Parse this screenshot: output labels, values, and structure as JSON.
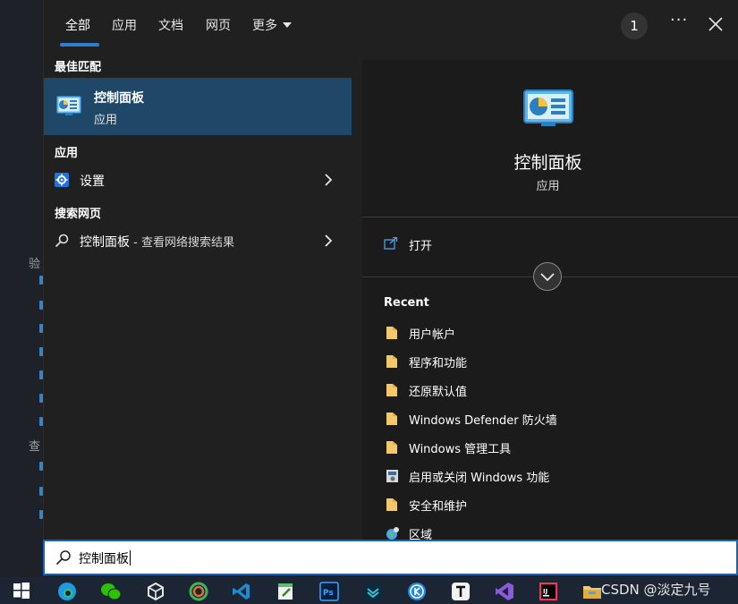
{
  "background": {
    "fragments": [
      "验",
      "查"
    ]
  },
  "tabs": [
    {
      "label": "全部",
      "active": true
    },
    {
      "label": "应用"
    },
    {
      "label": "文档"
    },
    {
      "label": "网页"
    },
    {
      "label": "更多"
    }
  ],
  "header": {
    "badge_count": "1",
    "more_options": "···"
  },
  "results": {
    "best_match_heading": "最佳匹配",
    "best_match": {
      "title": "控制面板",
      "subtitle": "应用"
    },
    "apps_heading": "应用",
    "apps": [
      {
        "label": "设置",
        "icon": "settings-icon"
      }
    ],
    "web_heading": "搜索网页",
    "web": {
      "query": "控制面板",
      "suffix": " - 查看网络搜索结果"
    }
  },
  "preview": {
    "title": "控制面板",
    "subtitle": "应用",
    "open_label": "打开",
    "recent_heading": "Recent",
    "recent": [
      {
        "label": "用户帐户",
        "icon": "folder-icon"
      },
      {
        "label": "程序和功能",
        "icon": "folder-icon"
      },
      {
        "label": "还原默认值",
        "icon": "folder-icon"
      },
      {
        "label": "Windows Defender 防火墙",
        "icon": "folder-icon"
      },
      {
        "label": "Windows 管理工具",
        "icon": "folder-icon"
      },
      {
        "label": "启用或关闭 Windows 功能",
        "icon": "windows-features-icon"
      },
      {
        "label": "安全和维护",
        "icon": "folder-icon"
      },
      {
        "label": "区域",
        "icon": "globe-icon"
      }
    ]
  },
  "search": {
    "value": "控制面板"
  },
  "taskbar": {
    "apps": [
      "start-icon",
      "edge-icon",
      "wechat-icon",
      "unity-icon",
      "anaconda-icon",
      "vscode-icon",
      "notepad-icon",
      "photoshop-icon",
      "bookmark-app-icon",
      "kugou-icon",
      "typora-icon",
      "visual-studio-icon",
      "intellij-icon",
      "file-explorer-icon"
    ],
    "watermark": "CSDN @淡定九号"
  },
  "colors": {
    "accent": "#2f7fd1",
    "selected_bg": "#1f4768",
    "search_border": "#0a67c7",
    "folder": "#f3c86a"
  }
}
